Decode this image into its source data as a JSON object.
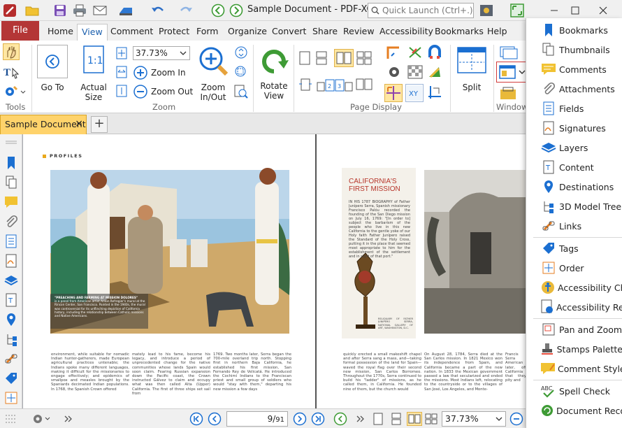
{
  "app": {
    "title": "Sample Document - PDF-XCha...",
    "search_placeholder": "Quick Launch (Ctrl+.)"
  },
  "ribbon_tabs": {
    "file": "File",
    "home": "Home",
    "view": "View",
    "comment": "Comment",
    "protect": "Protect",
    "form": "Form",
    "organize": "Organize",
    "convert": "Convert",
    "share": "Share",
    "review": "Review",
    "accessibility": "Accessibility",
    "bookmarks": "Bookmarks",
    "help": "Help"
  },
  "ribbon": {
    "tools_label": "Tools",
    "goto_label": "Go To",
    "actual_size_label": "Actual Size",
    "zoom_value": "37.73%",
    "zoom_in_label": "Zoom In",
    "zoom_out_label": "Zoom Out",
    "zoom_inout_label": "Zoom In/Out",
    "zoom_group_label": "Zoom",
    "rotate_label": "Rotate View",
    "page_display_label": "Page Display",
    "split_label": "Split",
    "window_label": "Window"
  },
  "document_tab": {
    "name": "Sample Document",
    "close": "×",
    "new": "+"
  },
  "pages": {
    "left": {
      "section": "PROFILES",
      "caption_title": "\"PREACHING AND FARMING AT MISSION DOLORES\"",
      "caption_body": "is a panel from American artist Anton Refregier's mural at the Rincon Center, San Francisco. Painted in the 1940s, the mural was controversial for its unflinching depiction of California history, including the relationship between Catholic missions and Native Americans.",
      "col1": "environment, while suitable for nomadic Indian hunter-gatherers, made European agricultural practices untenable; the Indians spoke many different languages, making it difficult for the missionaries to engage effectively; and epidemics of smallpox and measles brought by the Spaniards decimated Indian populations. In 1768, the Spanish Crown offered",
      "col2": "mately lead to his fame, become his legacy, and introduce a period of unprecedented change for the native communities whose lands Spain would soon claim. Fearing Russian expansion down the Pacific coast, the Crown instructed Gálvez to claim and occupy what was then called Alta (Upper) California. The first of three ships set sail from",
      "col3": "1769. Two months later, Serra began the 700-mile overland trip north. Stopping first in northern Baja California, he established his first mission, San Fernando Rey de Velicatá. He introduced the Cochimí Indians to the Franciscan priest and small group of soldiers who would \"stay with them,\" departing his new mission a few days"
    },
    "right": {
      "title": "CALIFORNIA'S FIRST MISSION",
      "intro": "IN HIS 1787 BIOGRAPHY of Father Junípero Serra, Spanish missionary Francisco Palóu recorded the founding of the San Diego mission on July 16, 1769: \"[In order to] subject the barbarism of the people who live in this new California to the gentle yoke of our Holy faith Father Junípero raised the Standard of the Holy Cross, putting it in the place that seemed most appropriate to him for the establishment of the settlement and in sight of that port.\"",
      "reliquary": "RELIQUARY OF FATHER JUNIPERO SERRA, NATIONAL GALLERY OF ART, WASHINGTON, D.C.",
      "col1": "quickly erected a small makeshift chapel and after Serra sang a mass, and—taking formal possession of the land for Spain—waved the royal flag over their second new mission, San Carlos Borromeo. Throughout the 1770s, Serra continued to build his \"ladder\" of missions, as he called them, in California. He founded nine of them, but the church would",
      "col2": "On August 28, 1784, Serra died at the San Carlos mission. In 1821 Mexico won its independence from Spain, and California became a part of the new nation. In 1833 the Mexican government passed a law that secularized and ended the missions. Most Indians left, relocating to the countryside or to the villages of San José, Los Angeles, and Monte-",
      "col3": "Francis Serra American later, off California that they pity and"
    }
  },
  "statusbar": {
    "page_current": "9",
    "page_total": "91",
    "zoom": "37.73%"
  },
  "panes_menu": {
    "items": [
      {
        "label": "Bookmarks",
        "icon": "bookmark-icon"
      },
      {
        "label": "Thumbnails",
        "icon": "thumbnails-icon"
      },
      {
        "label": "Comments",
        "icon": "comments-icon"
      },
      {
        "label": "Attachments",
        "icon": "paperclip-icon"
      },
      {
        "label": "Fields",
        "icon": "fields-icon"
      },
      {
        "label": "Signatures",
        "icon": "signatures-icon"
      },
      {
        "label": "Layers",
        "icon": "layers-icon"
      },
      {
        "label": "Content",
        "icon": "content-icon"
      },
      {
        "label": "Destinations",
        "icon": "destinations-icon"
      },
      {
        "label": "3D Model Tree",
        "icon": "model-tree-icon"
      },
      {
        "label": "Links",
        "icon": "links-icon"
      },
      {
        "label": "Tags",
        "icon": "tags-icon"
      },
      {
        "label": "Order",
        "icon": "order-icon"
      },
      {
        "label": "Accessibility Chec",
        "icon": "accessibility-check-icon"
      },
      {
        "label": "Accessibility Repo",
        "icon": "accessibility-report-icon"
      },
      {
        "label": "Pan and Zoom",
        "icon": "pan-zoom-icon"
      },
      {
        "label": "Stamps Palette",
        "icon": "stamps-icon"
      },
      {
        "label": "Comment Styles",
        "icon": "comment-styles-icon"
      },
      {
        "label": "Spell Check",
        "icon": "spell-check-icon"
      },
      {
        "label": "Document Recov",
        "icon": "document-recovery-icon"
      }
    ]
  },
  "colors": {
    "file_tab": "#b43636",
    "doc_tab": "#ffd36b",
    "accent_blue": "#1b6fd1",
    "accent_green": "#3e9b35"
  }
}
